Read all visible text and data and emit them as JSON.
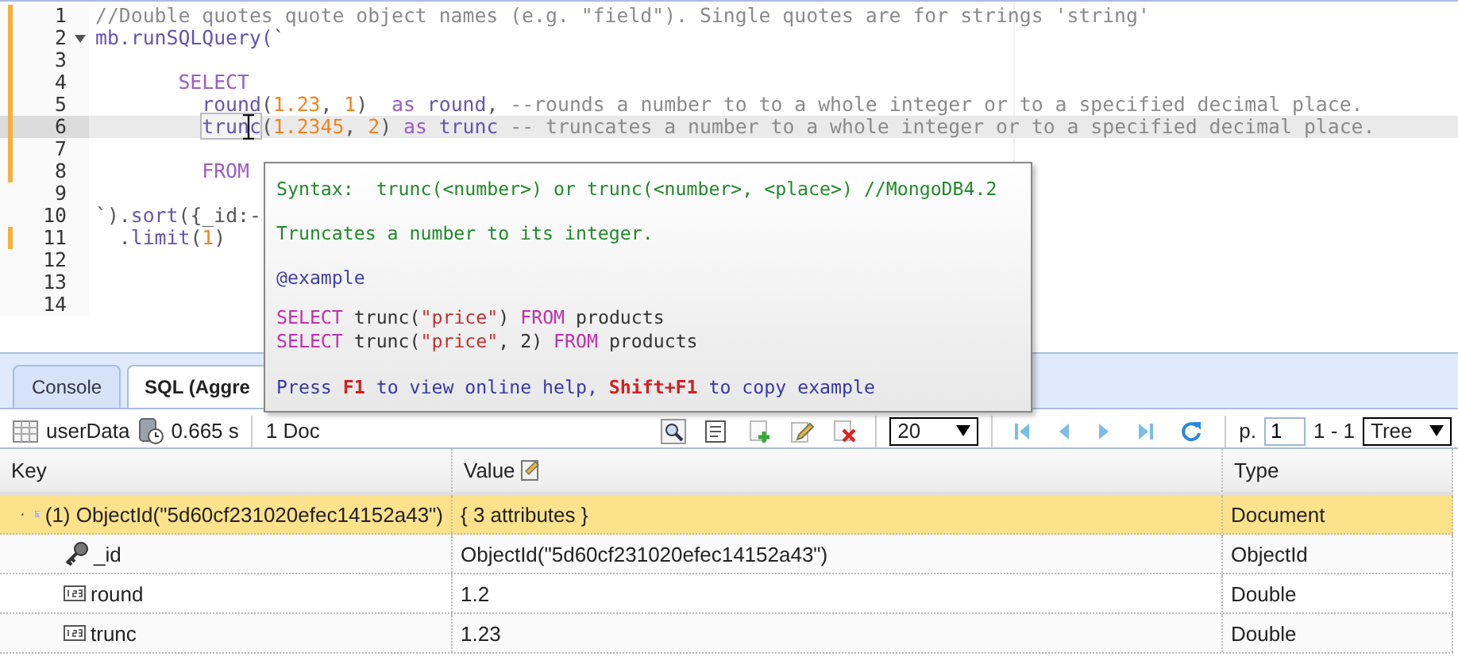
{
  "editor": {
    "lines": [
      {
        "number": "1",
        "changed": true,
        "current": false,
        "fold": false,
        "tokens": [
          {
            "kind": "comment",
            "text": "//Double quotes quote object names (e.g. \"field\"). Single quotes are for strings 'string'"
          }
        ]
      },
      {
        "number": "2",
        "changed": true,
        "current": false,
        "fold": true,
        "tokens": [
          {
            "kind": "fn",
            "text": "mb.runSQLQuery("
          },
          {
            "kind": "plain",
            "text": "`"
          }
        ]
      },
      {
        "number": "3",
        "changed": true,
        "current": false,
        "fold": false
      },
      {
        "number": "4",
        "changed": true,
        "current": false,
        "fold": false,
        "kind": "select",
        "tokens": [
          {
            "kind": "keyword",
            "text": "SELECT"
          }
        ]
      },
      {
        "number": "5",
        "changed": true,
        "current": false,
        "fold": false,
        "kind": "column",
        "tokens": [
          {
            "kind": "fn",
            "text": "round"
          },
          {
            "kind": "plain",
            "text": "("
          },
          {
            "kind": "number",
            "text": "1.23"
          },
          {
            "kind": "plain",
            "text": ", "
          },
          {
            "kind": "number",
            "text": "1"
          },
          {
            "kind": "plain",
            "text": ")  "
          },
          {
            "kind": "keyword",
            "text": "as"
          },
          {
            "kind": "fn",
            "text": " round"
          },
          {
            "kind": "plain",
            "text": ", "
          },
          {
            "kind": "comment",
            "text": "--rounds a number to to a whole integer or to a specified decimal place."
          }
        ]
      },
      {
        "number": "6",
        "changed": true,
        "current": true,
        "fold": false,
        "kind": "column",
        "tokens": [
          {
            "kind": "fn",
            "text": "trunc",
            "matched": true
          },
          {
            "kind": "plain",
            "text": "("
          },
          {
            "kind": "number",
            "text": "1.2345"
          },
          {
            "kind": "plain",
            "text": ", "
          },
          {
            "kind": "number",
            "text": "2"
          },
          {
            "kind": "plain",
            "text": ") "
          },
          {
            "kind": "keyword",
            "text": "as"
          },
          {
            "kind": "fn",
            "text": " trunc"
          },
          {
            "kind": "comment",
            "text": " -- truncates a number to a whole integer or to a specified decimal place."
          }
        ]
      },
      {
        "number": "7",
        "changed": true,
        "current": false,
        "fold": false
      },
      {
        "number": "8",
        "changed": true,
        "current": false,
        "fold": false,
        "kind": "column",
        "tokens": [
          {
            "kind": "keyword",
            "text": "FROM"
          }
        ]
      },
      {
        "number": "9",
        "changed": false,
        "current": false,
        "fold": false
      },
      {
        "number": "10",
        "changed": false,
        "current": false,
        "fold": false,
        "tokens": [
          {
            "kind": "plain",
            "text": "`)."
          },
          {
            "kind": "fn",
            "text": "sort"
          },
          {
            "kind": "plain",
            "text": "({_id:-"
          }
        ]
      },
      {
        "number": "11",
        "changed": true,
        "current": false,
        "fold": false,
        "kind": "call",
        "tokens": [
          {
            "kind": "plain",
            "text": "."
          },
          {
            "kind": "fn",
            "text": "limit"
          },
          {
            "kind": "plain",
            "text": "("
          },
          {
            "kind": "number",
            "text": "1"
          },
          {
            "kind": "plain",
            "text": ")"
          }
        ]
      },
      {
        "number": "12",
        "changed": false,
        "current": false,
        "fold": false
      },
      {
        "number": "13",
        "changed": false,
        "current": false,
        "fold": false
      },
      {
        "number": "14",
        "changed": false,
        "current": false,
        "fold": false
      }
    ]
  },
  "tooltip": {
    "lines": [
      {
        "kind": "syntax",
        "tokens": [
          {
            "kind": "plain",
            "text": "Syntax:  trunc(<number>) or trunc(<number>, <place>) //MongoDB4.2"
          }
        ]
      },
      {
        "kind": "syntax",
        "tokens": [
          {
            "kind": "plain",
            "text": "Truncates a number to its integer."
          }
        ]
      },
      {
        "kind": "tag",
        "tokens": [
          {
            "kind": "plain",
            "text": "@example"
          }
        ]
      },
      {
        "kind": "example",
        "tokens": [
          {
            "kind": "keyword",
            "text": "SELECT"
          },
          {
            "kind": "plain",
            "text": " trunc("
          },
          {
            "kind": "string",
            "text": "\"price\""
          },
          {
            "kind": "plain",
            "text": ") "
          },
          {
            "kind": "keyword",
            "text": "FROM"
          },
          {
            "kind": "plain",
            "text": " products"
          }
        ]
      },
      {
        "kind": "example",
        "tokens": [
          {
            "kind": "keyword",
            "text": "SELECT"
          },
          {
            "kind": "plain",
            "text": " trunc("
          },
          {
            "kind": "string",
            "text": "\"price\""
          },
          {
            "kind": "plain",
            "text": ", 2) "
          },
          {
            "kind": "keyword",
            "text": "FROM"
          },
          {
            "kind": "plain",
            "text": " products"
          }
        ]
      },
      {
        "kind": "help",
        "tokens": [
          {
            "kind": "plain",
            "text": "Press "
          },
          {
            "kind": "key",
            "text": "F1"
          },
          {
            "kind": "plain",
            "text": " to view online help, "
          },
          {
            "kind": "key",
            "text": "Shift+F1"
          },
          {
            "kind": "plain",
            "text": " to copy example"
          }
        ]
      }
    ]
  },
  "tabs": [
    {
      "label": "Console",
      "selected": false
    },
    {
      "label": "SQL (Aggre",
      "selected": true
    }
  ],
  "toolbar": {
    "collection": "userData",
    "time": "0.665 s",
    "count": "1 Doc",
    "page_size": "20",
    "page_label": "p.",
    "page": "1",
    "range": "1 - 1",
    "view": "Tree"
  },
  "table": {
    "columns": [
      {
        "label": "Key"
      },
      {
        "label": "Value"
      },
      {
        "label": "Type"
      }
    ],
    "rows": [
      {
        "kind": "document",
        "key": "(1) ObjectId(\"5d60cf231020efec14152a43\")",
        "value": "{ 3 attributes }",
        "type": "Document",
        "selected": true,
        "expanded": true,
        "children": [
          {
            "kind": "objectid",
            "key": "_id",
            "value": "ObjectId(\"5d60cf231020efec14152a43\")",
            "type": "ObjectId",
            "selected": false
          },
          {
            "kind": "double",
            "key": "round",
            "value": "1.2",
            "type": "Double",
            "selected": false
          },
          {
            "kind": "double",
            "key": "trunc",
            "value": "1.23",
            "type": "Double",
            "selected": false
          }
        ]
      }
    ]
  }
}
